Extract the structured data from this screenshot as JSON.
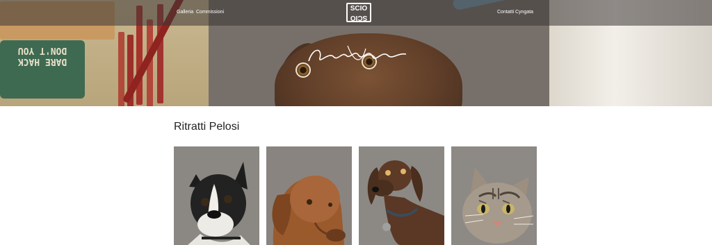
{
  "brand": {
    "logo_top": "SCIO",
    "logo_bottom": "SCIO",
    "signature_alt": "Claudia Scioni signature"
  },
  "nav": {
    "left": [
      "Galleria",
      "Commissioni"
    ],
    "right": [
      "Contatti",
      "Cyngata"
    ]
  },
  "hero": {
    "tin_text": [
      "DON'T YOU",
      "DARE HACK"
    ],
    "colors": {
      "tin": "#3f6a52",
      "brush": "#8e2320",
      "spatula": "#6f97ad"
    }
  },
  "section": {
    "title": "Ritratti Pelosi"
  },
  "gallery": {
    "items": [
      {
        "name": "boston-terrier-portrait",
        "icon": "boston-terrier"
      },
      {
        "name": "vizsla-portrait",
        "icon": "vizsla"
      },
      {
        "name": "dachshund-portrait",
        "icon": "dachshund"
      },
      {
        "name": "tabby-cat-portrait",
        "icon": "tabby-cat"
      }
    ]
  }
}
